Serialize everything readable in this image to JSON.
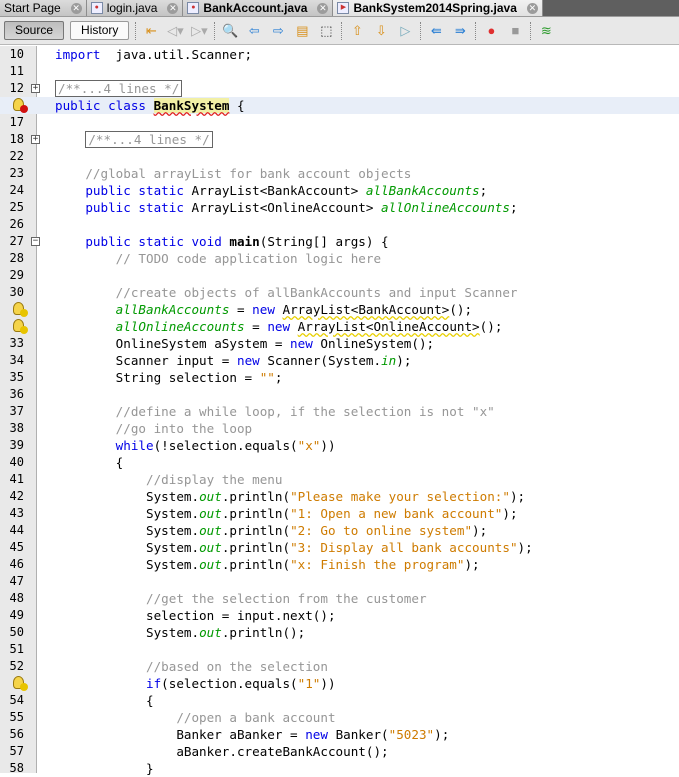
{
  "tabs": [
    {
      "label": "Start Page"
    },
    {
      "label": "login.java"
    },
    {
      "label": "BankAccount.java"
    },
    {
      "label": "BankSystem2014Spring.java"
    }
  ],
  "toolbar": {
    "source": "Source",
    "history": "History"
  },
  "lines": [
    {
      "n": "10",
      "c": [
        [
          "kw",
          "import"
        ],
        [
          "",
          "  java.util.Scanner;"
        ]
      ]
    },
    {
      "n": "11",
      "c": []
    },
    {
      "n": "12",
      "fold": "+",
      "c": [
        [
          "fb",
          "/**...4 lines */"
        ]
      ]
    },
    {
      "n": "",
      "icon": "err",
      "hl": true,
      "c": [
        [
          "kw",
          "public class "
        ],
        [
          "cls",
          "BankSystem"
        ],
        [
          "",
          " {"
        ]
      ]
    },
    {
      "n": "17",
      "c": []
    },
    {
      "n": "18",
      "fold": "+",
      "c": [
        [
          "",
          "    "
        ],
        [
          "fb",
          "/**...4 lines */"
        ]
      ]
    },
    {
      "n": "22",
      "c": []
    },
    {
      "n": "23",
      "c": [
        [
          "cm",
          "    //global arrayList for bank account objects"
        ]
      ]
    },
    {
      "n": "24",
      "c": [
        [
          "kw",
          "    public static "
        ],
        [
          "",
          "ArrayList<BankAccount> "
        ],
        [
          "fd",
          "allBankAccounts"
        ],
        [
          "",
          ";"
        ]
      ]
    },
    {
      "n": "25",
      "c": [
        [
          "kw",
          "    public static "
        ],
        [
          "",
          "ArrayList<OnlineAccount> "
        ],
        [
          "fd",
          "allOnlineAccounts"
        ],
        [
          "",
          ";"
        ]
      ]
    },
    {
      "n": "26",
      "c": []
    },
    {
      "n": "27",
      "fold": "−",
      "c": [
        [
          "kw",
          "    public static void "
        ],
        [
          "bd",
          "main"
        ],
        [
          "",
          "(String[] args) {"
        ]
      ]
    },
    {
      "n": "28",
      "c": [
        [
          "cm",
          "        // TODO code application logic here"
        ]
      ]
    },
    {
      "n": "29",
      "c": []
    },
    {
      "n": "30",
      "c": [
        [
          "cm",
          "        //create objects of allBankAccounts and input Scanner"
        ]
      ]
    },
    {
      "n": "",
      "icon": "warn",
      "c": [
        [
          "",
          "        "
        ],
        [
          "fd",
          "allBankAccounts"
        ],
        [
          "",
          " = "
        ],
        [
          "kw",
          "new "
        ],
        [
          "wv",
          "ArrayList<BankAccount>"
        ],
        [
          "",
          "();"
        ]
      ]
    },
    {
      "n": "",
      "icon": "warn",
      "c": [
        [
          "",
          "        "
        ],
        [
          "fd",
          "allOnlineAccounts"
        ],
        [
          "",
          " = "
        ],
        [
          "kw",
          "new "
        ],
        [
          "wv",
          "ArrayList<OnlineAccount>"
        ],
        [
          "",
          "();"
        ]
      ]
    },
    {
      "n": "33",
      "c": [
        [
          "",
          "        OnlineSystem aSystem = "
        ],
        [
          "kw",
          "new "
        ],
        [
          "",
          "OnlineSystem();"
        ]
      ]
    },
    {
      "n": "34",
      "c": [
        [
          "",
          "        Scanner input = "
        ],
        [
          "kw",
          "new "
        ],
        [
          "",
          "Scanner(System."
        ],
        [
          "fd",
          "in"
        ],
        [
          "",
          ");"
        ]
      ]
    },
    {
      "n": "35",
      "c": [
        [
          "",
          "        String selection = "
        ],
        [
          "st",
          "\"\""
        ],
        [
          "",
          ";"
        ]
      ]
    },
    {
      "n": "36",
      "c": []
    },
    {
      "n": "37",
      "c": [
        [
          "cm",
          "        //define a while loop, if the selection is not \"x\""
        ]
      ]
    },
    {
      "n": "38",
      "c": [
        [
          "cm",
          "        //go into the loop"
        ]
      ]
    },
    {
      "n": "39",
      "c": [
        [
          "kw",
          "        while"
        ],
        [
          "",
          "(!selection.equals("
        ],
        [
          "st",
          "\"x\""
        ],
        [
          "",
          "))"
        ]
      ]
    },
    {
      "n": "40",
      "c": [
        [
          "",
          "        {"
        ]
      ]
    },
    {
      "n": "41",
      "c": [
        [
          "cm",
          "            //display the menu"
        ]
      ]
    },
    {
      "n": "42",
      "c": [
        [
          "",
          "            System."
        ],
        [
          "fd",
          "out"
        ],
        [
          "",
          ".println("
        ],
        [
          "st",
          "\"Please make your selection:\""
        ],
        [
          "",
          ");"
        ]
      ]
    },
    {
      "n": "43",
      "c": [
        [
          "",
          "            System."
        ],
        [
          "fd",
          "out"
        ],
        [
          "",
          ".println("
        ],
        [
          "st",
          "\"1: Open a new bank account\""
        ],
        [
          "",
          ");"
        ]
      ]
    },
    {
      "n": "44",
      "c": [
        [
          "",
          "            System."
        ],
        [
          "fd",
          "out"
        ],
        [
          "",
          ".println("
        ],
        [
          "st",
          "\"2: Go to online system\""
        ],
        [
          "",
          ");"
        ]
      ]
    },
    {
      "n": "45",
      "c": [
        [
          "",
          "            System."
        ],
        [
          "fd",
          "out"
        ],
        [
          "",
          ".println("
        ],
        [
          "st",
          "\"3: Display all bank accounts\""
        ],
        [
          "",
          ");"
        ]
      ]
    },
    {
      "n": "46",
      "c": [
        [
          "",
          "            System."
        ],
        [
          "fd",
          "out"
        ],
        [
          "",
          ".println("
        ],
        [
          "st",
          "\"x: Finish the program\""
        ],
        [
          "",
          ");"
        ]
      ]
    },
    {
      "n": "47",
      "c": []
    },
    {
      "n": "48",
      "c": [
        [
          "cm",
          "            //get the selection from the customer"
        ]
      ]
    },
    {
      "n": "49",
      "c": [
        [
          "",
          "            selection = input.next();"
        ]
      ]
    },
    {
      "n": "50",
      "c": [
        [
          "",
          "            System."
        ],
        [
          "fd",
          "out"
        ],
        [
          "",
          ".println();"
        ]
      ]
    },
    {
      "n": "51",
      "c": []
    },
    {
      "n": "52",
      "c": [
        [
          "cm",
          "            //based on the selection"
        ]
      ]
    },
    {
      "n": "",
      "icon": "warn",
      "c": [
        [
          "kw",
          "            if"
        ],
        [
          "",
          "(selection.equals("
        ],
        [
          "st",
          "\"1\""
        ],
        [
          "",
          "))"
        ]
      ]
    },
    {
      "n": "54",
      "c": [
        [
          "",
          "            {"
        ]
      ]
    },
    {
      "n": "55",
      "c": [
        [
          "cm",
          "                //open a bank account"
        ]
      ]
    },
    {
      "n": "56",
      "c": [
        [
          "",
          "                Banker aBanker = "
        ],
        [
          "kw",
          "new "
        ],
        [
          "",
          "Banker("
        ],
        [
          "st",
          "\"5023\""
        ],
        [
          "",
          ");"
        ]
      ]
    },
    {
      "n": "57",
      "c": [
        [
          "",
          "                aBanker.createBankAccount();"
        ]
      ]
    },
    {
      "n": "58",
      "c": [
        [
          "",
          "            }"
        ]
      ]
    }
  ]
}
